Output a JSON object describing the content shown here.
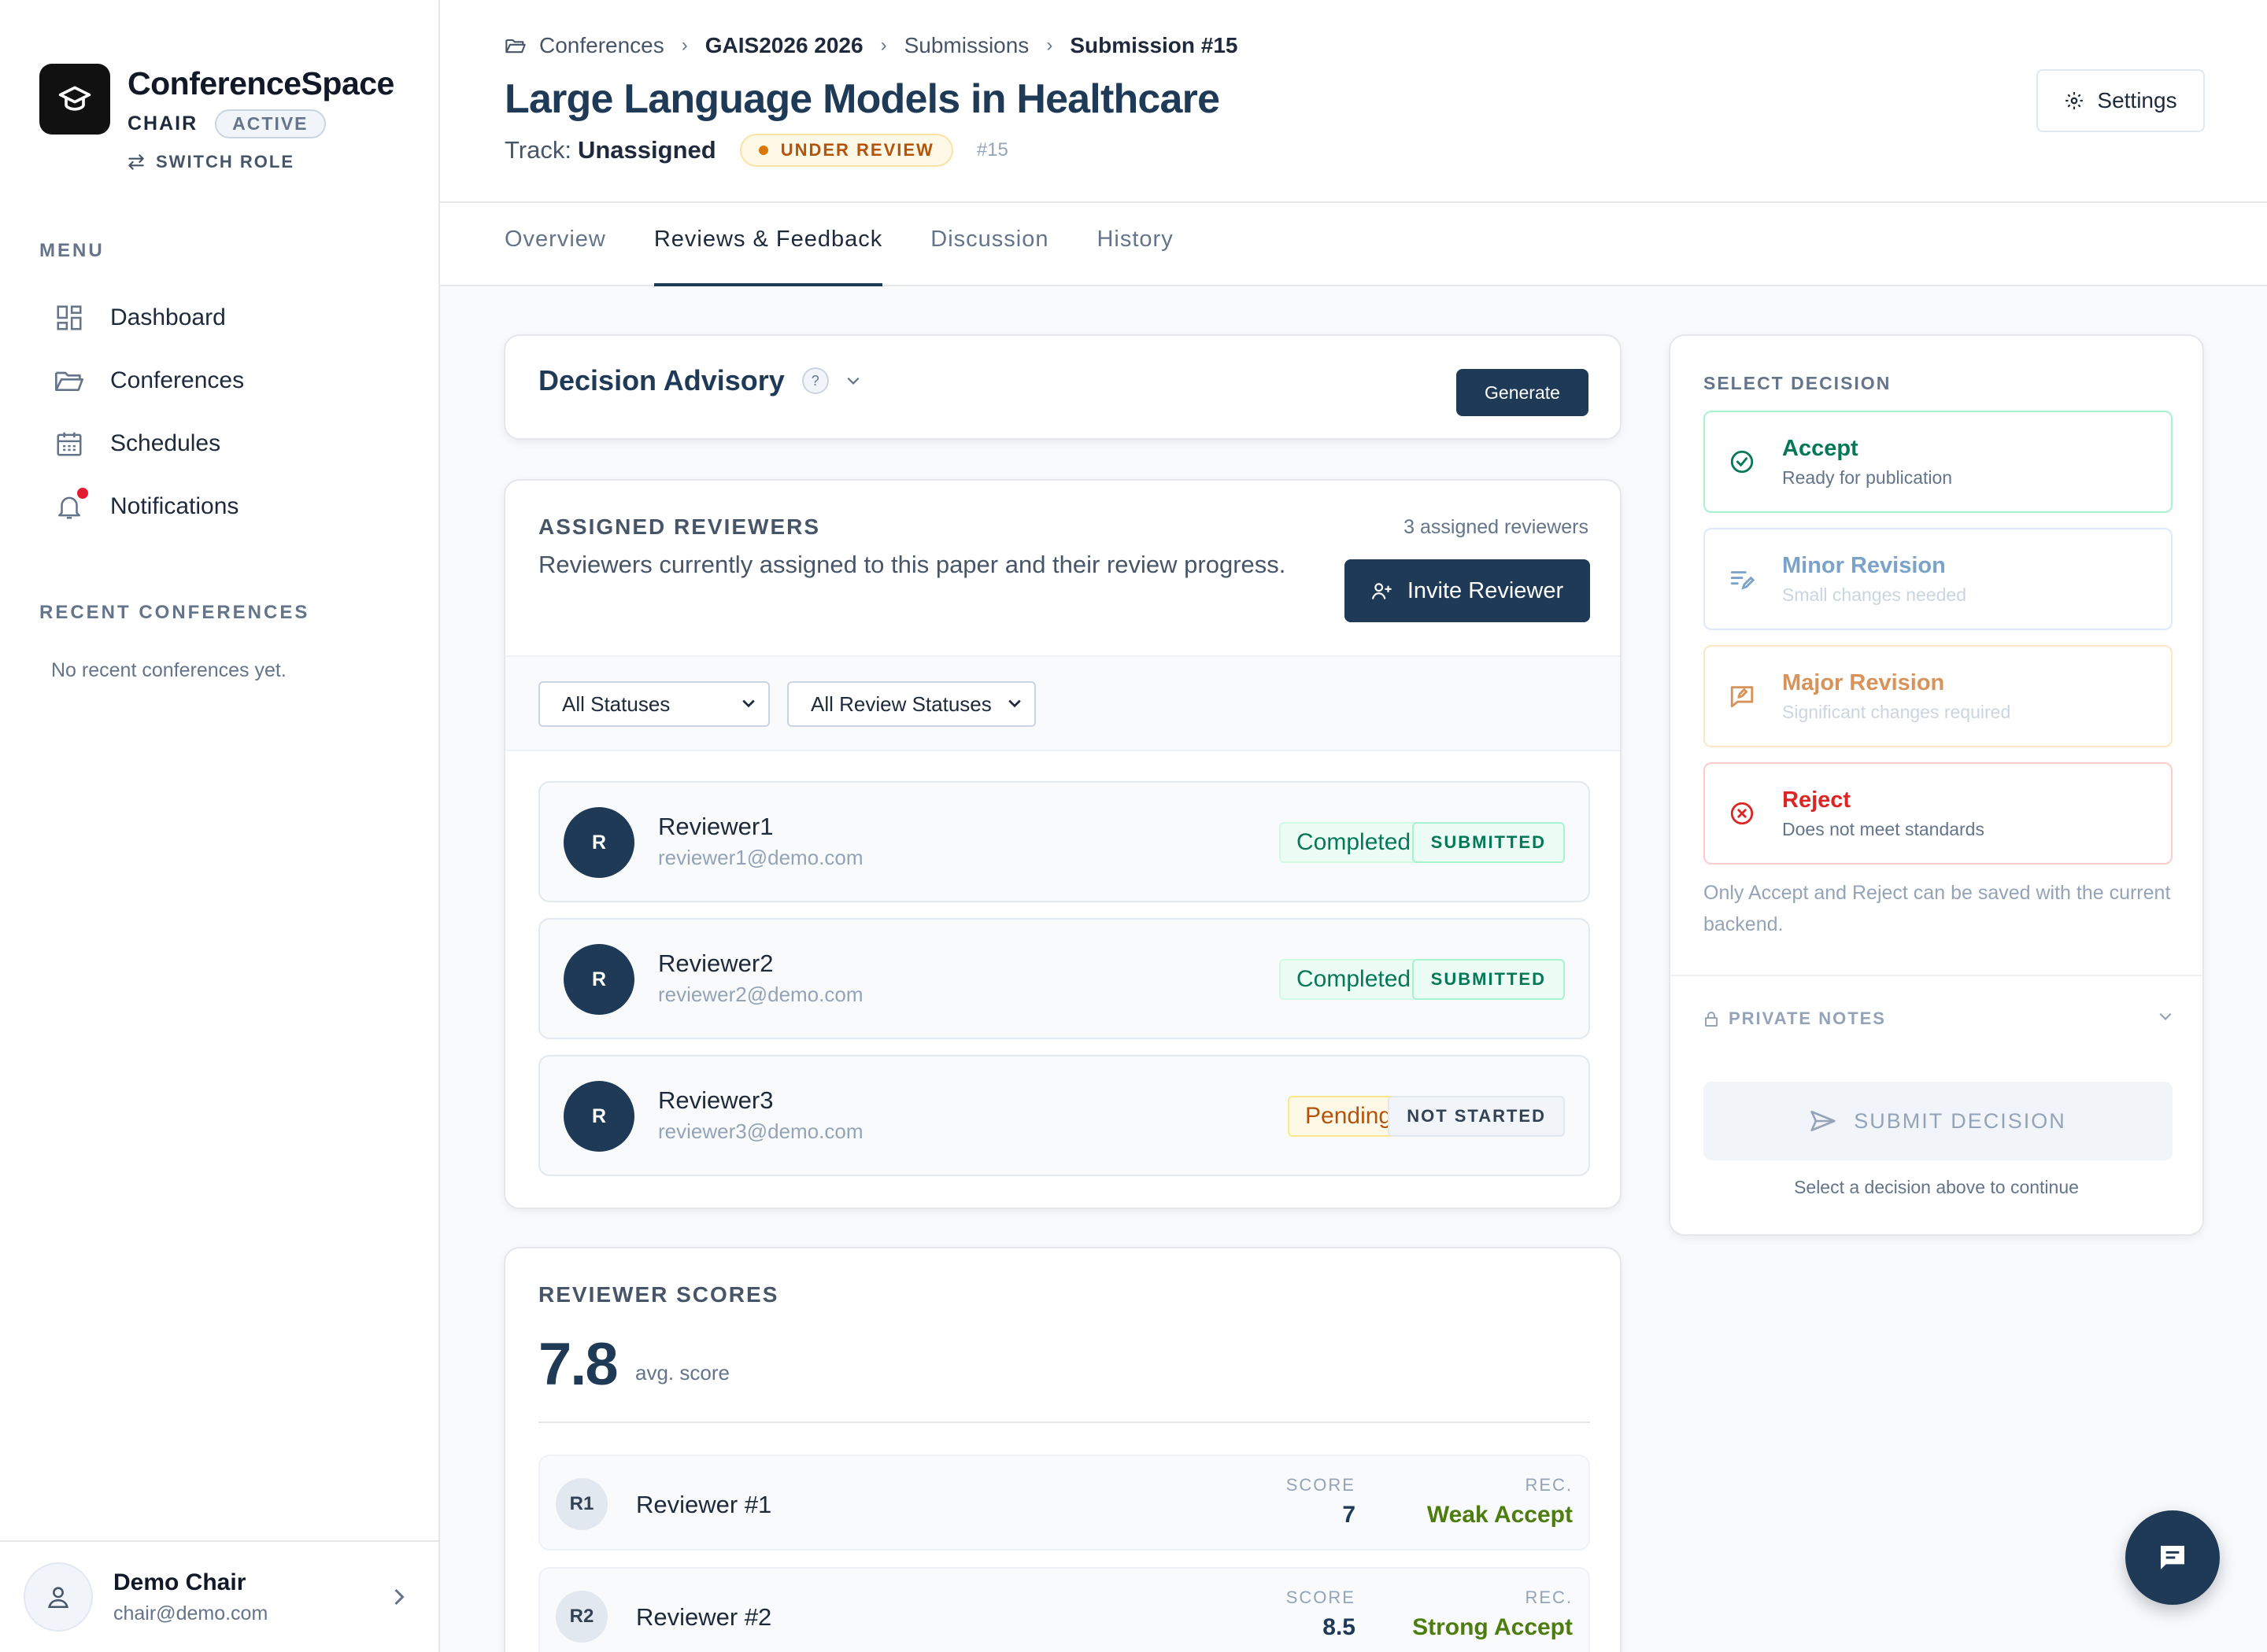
{
  "app": {
    "name": "ConferenceSpace",
    "role": "CHAIR",
    "role_status": "ACTIVE",
    "switch_role": "SWITCH ROLE"
  },
  "sidebar": {
    "menu_heading": "MENU",
    "items": [
      {
        "label": "Dashboard",
        "icon": "dashboard-icon"
      },
      {
        "label": "Conferences",
        "icon": "folder-icon"
      },
      {
        "label": "Schedules",
        "icon": "calendar-icon"
      },
      {
        "label": "Notifications",
        "icon": "bell-icon",
        "has_unread": true
      }
    ],
    "recent_heading": "RECENT CONFERENCES",
    "recent_empty": "No recent conferences yet."
  },
  "user": {
    "name": "Demo Chair",
    "email": "chair@demo.com"
  },
  "breadcrumb": {
    "items": [
      "Conferences",
      "GAIS2026 2026",
      "Submissions",
      "Submission #15"
    ]
  },
  "submission": {
    "title": "Large Language Models in Healthcare",
    "track_label": "Track:",
    "track_value": "Unassigned",
    "status": "UNDER REVIEW",
    "number": "#15"
  },
  "header": {
    "settings_label": "Settings"
  },
  "tabs": [
    {
      "label": "Overview",
      "active": false
    },
    {
      "label": "Reviews & Feedback",
      "active": true
    },
    {
      "label": "Discussion",
      "active": false
    },
    {
      "label": "History",
      "active": false
    }
  ],
  "advisory": {
    "title": "Decision Advisory",
    "help": "?",
    "generate_label": "Generate"
  },
  "reviewers": {
    "heading": "ASSIGNED REVIEWERS",
    "count_text": "3 assigned reviewers",
    "description": "Reviewers currently assigned to this paper and their review progress.",
    "invite_label": "Invite Reviewer",
    "filter_status": "All Statuses",
    "filter_review_status": "All Review Statuses",
    "list": [
      {
        "initial": "R",
        "name": "Reviewer1",
        "email": "reviewer1@demo.com",
        "status": "Completed",
        "tag": "SUBMITTED"
      },
      {
        "initial": "R",
        "name": "Reviewer2",
        "email": "reviewer2@demo.com",
        "status": "Completed",
        "tag": "SUBMITTED"
      },
      {
        "initial": "R",
        "name": "Reviewer3",
        "email": "reviewer3@demo.com",
        "status": "Pending",
        "tag": "NOT STARTED"
      }
    ]
  },
  "scores": {
    "heading": "REVIEWER SCORES",
    "avg_value": "7.8",
    "avg_label": "avg. score",
    "score_caption": "SCORE",
    "rec_caption": "REC.",
    "rows": [
      {
        "badge": "R1",
        "name": "Reviewer #1",
        "score": "7",
        "rec": "Weak Accept"
      },
      {
        "badge": "R2",
        "name": "Reviewer #2",
        "score": "8.5",
        "rec": "Strong Accept"
      }
    ]
  },
  "decision": {
    "heading": "SELECT DECISION",
    "options": [
      {
        "title": "Accept",
        "subtitle": "Ready for publication",
        "color": "#047857"
      },
      {
        "title": "Minor Revision",
        "subtitle": "Small changes needed",
        "color": "#7ba3c9"
      },
      {
        "title": "Major Revision",
        "subtitle": "Significant changes required",
        "color": "#d7935a"
      },
      {
        "title": "Reject",
        "subtitle": "Does not meet standards",
        "color": "#dc2626"
      }
    ],
    "note": "Only Accept and Reject can be saved with the current backend.",
    "private_notes": "PRIVATE NOTES",
    "submit_label": "SUBMIT DECISION",
    "submit_hint": "Select a decision above to continue"
  },
  "colors": {
    "primary": "#1e3a56",
    "accept": "#047857",
    "reject": "#dc2626",
    "warning": "#b45309"
  }
}
